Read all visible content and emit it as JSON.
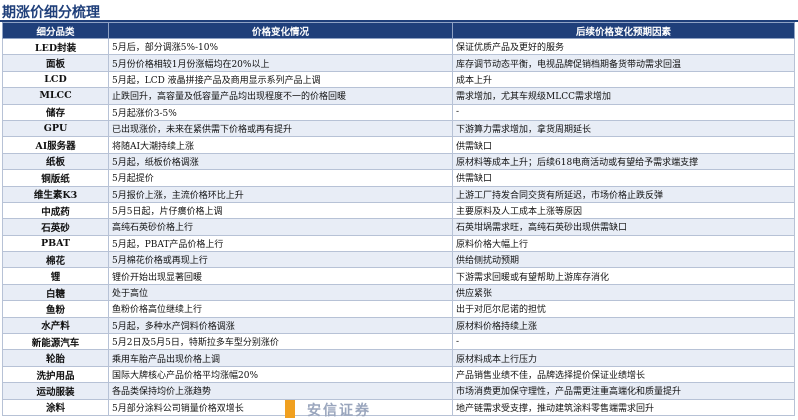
{
  "title": "期涨价细分梳理",
  "headers": [
    "细分品类",
    "价格变化情况",
    "后续价格变化预期因素"
  ],
  "rows": [
    {
      "category": "LED封装",
      "price_change": "5月后，部分调涨5%-10%",
      "outlook": "保证优质产品及更好的服务"
    },
    {
      "category": "面板",
      "price_change": "5月份价格相较1月份涨幅均在20%以上",
      "outlook": "库存调节动态平衡，电视品牌促销档期备货带动需求回温"
    },
    {
      "category": "LCD",
      "price_change": "5月起，LCD 液晶拼接产品及商用显示系列产品上调",
      "outlook": "成本上升"
    },
    {
      "category": "MLCC",
      "price_change": "止跌回升，高容量及低容量产品均出现程度不一的价格回暖",
      "outlook": "需求增加，尤其车规级MLCC需求增加"
    },
    {
      "category": "储存",
      "price_change": "5月起涨价3-5%",
      "outlook": "-"
    },
    {
      "category": "GPU",
      "price_change": "已出现涨价，未来在紧供需下价格或再有提升",
      "outlook": "下游算力需求增加，拿货周期延长"
    },
    {
      "category": "AI服务器",
      "price_change": "将随AI大潮持续上涨",
      "outlook": "供需缺口"
    },
    {
      "category": "纸板",
      "price_change": "5月起，纸板价格调涨",
      "outlook": "原材料等成本上升；后续618电商活动或有望给予需求端支撑"
    },
    {
      "category": "铜版纸",
      "price_change": "5月起提价",
      "outlook": "供需缺口"
    },
    {
      "category": "维生素K3",
      "price_change": "5月报价上涨，主流价格环比上升",
      "outlook": "上游工厂持发合同交货有所延迟，市场价格止跌反弹"
    },
    {
      "category": "中成药",
      "price_change": "5月5日起，片仔癀价格上调",
      "outlook": "主要原料及人工成本上涨等原因"
    },
    {
      "category": "石英砂",
      "price_change": "高纯石英砂价格上行",
      "outlook": "石英坩埚需求旺，高纯石英砂出现供需缺口"
    },
    {
      "category": "PBAT",
      "price_change": "5月起，PBAT产品价格上行",
      "outlook": "原料价格大幅上行"
    },
    {
      "category": "棉花",
      "price_change": "5月棉花价格或再现上行",
      "outlook": "供给侧扰动预期"
    },
    {
      "category": "锂",
      "price_change": "锂价开始出现显著回暖",
      "outlook": "下游需求回暖或有望帮助上游库存消化"
    },
    {
      "category": "白糖",
      "price_change": "处于高位",
      "outlook": "供应紧张"
    },
    {
      "category": "鱼粉",
      "price_change": "鱼粉价格高位继续上行",
      "outlook": "出于对厄尔尼诺的担忧"
    },
    {
      "category": "水产料",
      "price_change": "5月起，多种水产饲料价格调涨",
      "outlook": "原材料价格持续上涨"
    },
    {
      "category": "新能源汽车",
      "price_change": "5月2日及5月5日，特斯拉多车型分别涨价",
      "outlook": "-"
    },
    {
      "category": "轮胎",
      "price_change": "乘用车胎产品出现价格上调",
      "outlook": "原材料成本上行压力"
    },
    {
      "category": "洗护用品",
      "price_change": "国际大牌核心产品价格平均涨幅20%",
      "outlook": "产品销售业绩不佳，品牌选择提价保证业绩增长"
    },
    {
      "category": "运动服装",
      "price_change": "各品类保持均价上涨趋势",
      "outlook": "市场消费更加保守理性，产品需更注重高端化和质量提升"
    },
    {
      "category": "涂料",
      "price_change": "5月部分涂料公司销量价格双增长",
      "outlook": "地产链需求受支撑，推动建筑涂料零售端需求回升"
    }
  ],
  "watermark": "安信证券"
}
